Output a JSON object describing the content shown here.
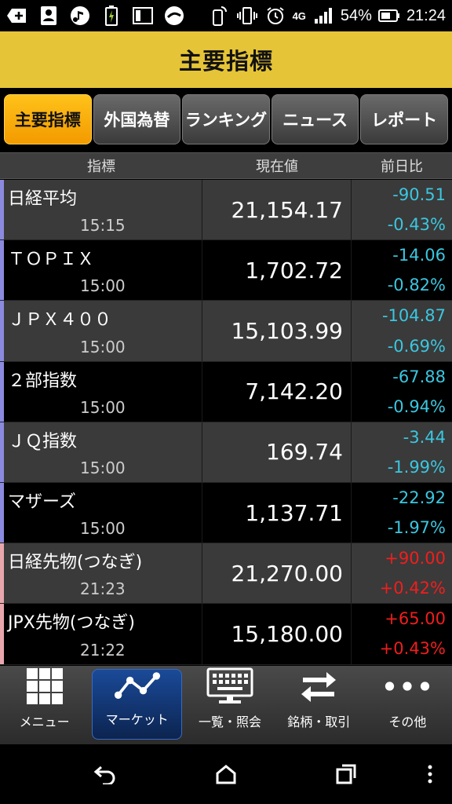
{
  "status_bar": {
    "battery": "54%",
    "time": "21:24",
    "network": "4G"
  },
  "header": {
    "title": "主要指標"
  },
  "tabs": [
    {
      "label": "主要指標",
      "active": true
    },
    {
      "label": "外国為替",
      "active": false
    },
    {
      "label": "ランキング",
      "active": false
    },
    {
      "label": "ニュース",
      "active": false
    },
    {
      "label": "レポート",
      "active": false
    }
  ],
  "table": {
    "columns": [
      "指標",
      "現在値",
      "前日比"
    ],
    "rows": [
      {
        "name": "日経平均",
        "time": "15:15",
        "value": "21,154.17",
        "change": "-90.51",
        "change_pct": "-0.43%",
        "direction": "down"
      },
      {
        "name": "ＴＯＰＩＸ",
        "time": "15:00",
        "value": "1,702.72",
        "change": "-14.06",
        "change_pct": "-0.82%",
        "direction": "down"
      },
      {
        "name": "ＪＰＸ４００",
        "time": "15:00",
        "value": "15,103.99",
        "change": "-104.87",
        "change_pct": "-0.69%",
        "direction": "down"
      },
      {
        "name": "２部指数",
        "time": "15:00",
        "value": "7,142.20",
        "change": "-67.88",
        "change_pct": "-0.94%",
        "direction": "down"
      },
      {
        "name": "ＪＱ指数",
        "time": "15:00",
        "value": "169.74",
        "change": "-3.44",
        "change_pct": "-1.99%",
        "direction": "down"
      },
      {
        "name": "マザーズ",
        "time": "15:00",
        "value": "1,137.71",
        "change": "-22.92",
        "change_pct": "-1.97%",
        "direction": "down"
      },
      {
        "name": "日経先物(つなぎ)",
        "time": "21:23",
        "value": "21,270.00",
        "change": "+90.00",
        "change_pct": "+0.42%",
        "direction": "up"
      },
      {
        "name": "JPX先物(つなぎ)",
        "time": "21:22",
        "value": "15,180.00",
        "change": "+65.00",
        "change_pct": "+0.43%",
        "direction": "up"
      }
    ]
  },
  "bottom_nav": [
    {
      "label": "メニュー",
      "icon": "grid-icon",
      "active": false
    },
    {
      "label": "マーケット",
      "icon": "chart-line-icon",
      "active": true
    },
    {
      "label": "一覧・照会",
      "icon": "monitor-keyboard-icon",
      "active": false
    },
    {
      "label": "銘柄・取引",
      "icon": "swap-arrows-icon",
      "active": false
    },
    {
      "label": "その他",
      "icon": "more-dots-icon",
      "active": false
    }
  ],
  "colors": {
    "header_bg": "#e5c437",
    "tab_active": "#f8a800",
    "negative": "#3ac7e0",
    "positive": "#f21d1d",
    "nav_active": "#1a4a98"
  }
}
